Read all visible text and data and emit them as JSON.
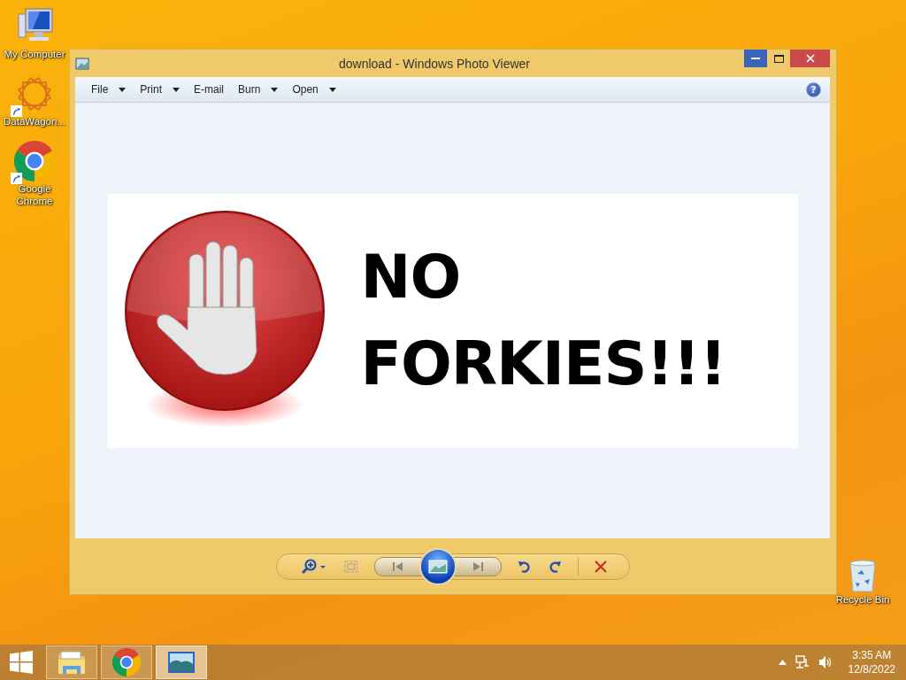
{
  "desktop_icons": [
    {
      "kind": "computer",
      "label": "My Computer",
      "shortcut": false
    },
    {
      "kind": "star",
      "label": "DataWagon...",
      "shortcut": true
    },
    {
      "kind": "chrome",
      "label": "Google Chrome",
      "shortcut": true
    }
  ],
  "recycle_bin": {
    "label": "Recycle Bin"
  },
  "window": {
    "title": "download - Windows Photo Viewer",
    "menu": [
      {
        "label": "File",
        "dropdown": true
      },
      {
        "label": "Print",
        "dropdown": true
      },
      {
        "label": "E-mail",
        "dropdown": false
      },
      {
        "label": "Burn",
        "dropdown": true
      },
      {
        "label": "Open",
        "dropdown": true
      }
    ],
    "help": "?",
    "image": {
      "lines": [
        "NO",
        "FORKIES!!!"
      ]
    }
  },
  "taskbar": {
    "items": [
      {
        "kind": "explorer",
        "selected": false
      },
      {
        "kind": "chrome",
        "selected": false
      },
      {
        "kind": "photos",
        "selected": true
      }
    ],
    "time": "3:35 AM",
    "date": "12/8/2022"
  }
}
